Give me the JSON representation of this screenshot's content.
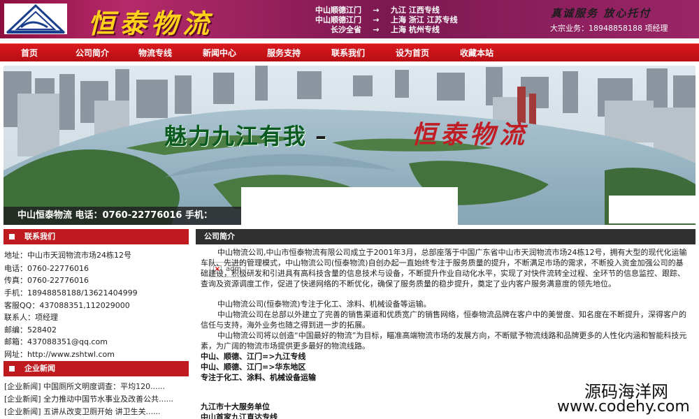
{
  "header": {
    "brand": "恒泰物流",
    "routes": [
      {
        "from": "中山顺德江门",
        "arrow": "→",
        "to": "九江  江西专线"
      },
      {
        "from": "中山顺德江门",
        "arrow": "→",
        "to": "上海  浙江  江苏专线"
      },
      {
        "from": "长沙全省",
        "arrow": "→",
        "to": "上海  杭州专线"
      }
    ],
    "slogan": "真诚服务  放心托付",
    "hotline": "大宗业务：18948858188   项经理"
  },
  "nav": [
    "首页",
    "公司简介",
    "物流专线",
    "新闻中心",
    "服务支持",
    "联系我们",
    "设为首页",
    "收藏本站"
  ],
  "banner": {
    "title": "魅力九江有我",
    "dash": "–",
    "brand": "恒泰物流",
    "phone_line": "中山恒泰物流 电话：0760-22776016 手机："
  },
  "contact": {
    "heading": "联系我们",
    "rows": [
      "地址：中山市天润物流市场24栋12号",
      "电话：0760-22776016",
      "传真：0760-22776016",
      "手机：18948858188/13621404999",
      "客服QQ：437088351,112029000",
      "联系人：项经理",
      "邮编：528402",
      "邮箱：437088351@qq.com",
      "网址：http://www.zshtwl.com"
    ]
  },
  "news": {
    "heading": "企业新闻",
    "items": [
      "[企业新闻] 中国厕所文明度调查：平均120......",
      "[企业新闻] 全力推动中国节水事业及改善公共......",
      "[企业新闻] 五讲从改变卫厕开始 讲卫生关......"
    ]
  },
  "about": {
    "heading": "公司简介",
    "image_alt": "adm",
    "paragraphs": [
      "中山物流公司,中山市恒泰物流有限公司成立于2001年3月，总部座落于中国广东省中山市天润物流市场24栋12号，拥有大型的现代化运输车队、先进的管理模式，中山物流公司(恒泰物流)自创办起一直始终专注于服务质量的提升，不断满足市场的需求，不断投入资金加强公司的基础建设，积极研发和引进具有高科技含量的信息技术与设备，不断提升作业自动化水平，实现了对快件流转全过程、全环节的信息监控、跟踪、查询及资源调度工作，促进了快递网络的不断优化，确保了服务质量的稳步提升，奠定了业内客户服务满意度的领先地位。",
      "中山物流公司(恒泰物流)专注于化工、涂料、机械设备等运输。",
      "中山物流公司在总部以外建立了完善的销售渠道和优质宽广的销售网络，恒泰物流品牌在客户中的美誉度、知名度在不断提升，深得客户的信任与支持，海外业务也随之得到进一步的拓展。",
      "中山物流公司将以创造“中国最好的物流”为目标，瞄准高端物流市场的发展方向，不断赋予物流线路和品牌更多的人性化内涵和智能科技元素，为广阔的物流市场提供更多最好的物流线路。"
    ],
    "routes": [
      "中山、顺德、江门=>九江专线",
      "中山、顺德、江门=>华东地区",
      "专注于化工、涂料、机械设备运输"
    ],
    "more": [
      "九江市十大服务单位",
      "中山首家九江直达专线"
    ]
  },
  "watermark": {
    "line1": "源码海洋网",
    "line2": "www.codehy.com"
  },
  "colors": {
    "header_bg": "#8d0f3f",
    "nav_bg": "#c8141a",
    "brand_yellow": "#ffd21b",
    "panel_red": "#be1a1f",
    "about_dark": "#2f2f2f"
  }
}
